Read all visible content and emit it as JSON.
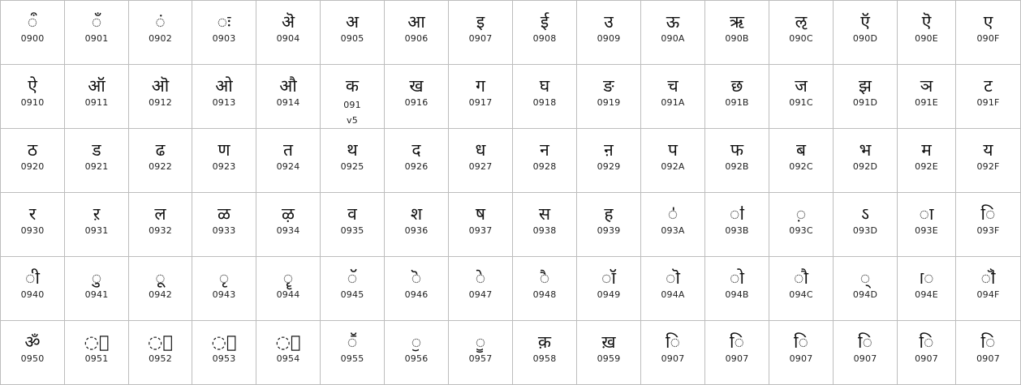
{
  "cells": [
    {
      "glyph": "◌ऀ",
      "code": "0900"
    },
    {
      "glyph": "◌ँ",
      "code": "0901"
    },
    {
      "glyph": "◌ं",
      "code": "0902"
    },
    {
      "glyph": "◌ः",
      "code": "0903"
    },
    {
      "glyph": "ऄ",
      "code": "0904"
    },
    {
      "glyph": "अ",
      "code": "0905"
    },
    {
      "glyph": "आ",
      "code": "0906"
    },
    {
      "glyph": "इ",
      "code": "0907"
    },
    {
      "glyph": "ई",
      "code": "0908"
    },
    {
      "glyph": "उ",
      "code": "0909"
    },
    {
      "glyph": "ऊ",
      "code": "090A"
    },
    {
      "glyph": "ऋ",
      "code": "090B"
    },
    {
      "glyph": "ऌ",
      "code": "090C"
    },
    {
      "glyph": "ऍ",
      "code": "090D"
    },
    {
      "glyph": "ऎ",
      "code": "090E"
    },
    {
      "glyph": "ए",
      "code": "090F"
    },
    {
      "glyph": "ऐ",
      "code": "0910"
    },
    {
      "glyph": "ऑ",
      "code": "0911"
    },
    {
      "glyph": "ऒ",
      "code": "0912"
    },
    {
      "glyph": "ओ",
      "code": "0913"
    },
    {
      "glyph": "औ",
      "code": "0914"
    },
    {
      "glyph": "क",
      "code": "091v5"
    },
    {
      "glyph": "ख",
      "code": "0916"
    },
    {
      "glyph": "ग",
      "code": "0917"
    },
    {
      "glyph": "घ",
      "code": "0918"
    },
    {
      "glyph": "ङ",
      "code": "0919"
    },
    {
      "glyph": "च",
      "code": "091A"
    },
    {
      "glyph": "छ",
      "code": "091B"
    },
    {
      "glyph": "ज",
      "code": "091C"
    },
    {
      "glyph": "झ",
      "code": "091D"
    },
    {
      "glyph": "ञ",
      "code": "091E"
    },
    {
      "glyph": "ट",
      "code": "091F"
    },
    {
      "glyph": "ठ",
      "code": "0920"
    },
    {
      "glyph": "ड",
      "code": "0921"
    },
    {
      "glyph": "ढ",
      "code": "0922"
    },
    {
      "glyph": "ण",
      "code": "0923"
    },
    {
      "glyph": "त",
      "code": "0924"
    },
    {
      "glyph": "थ",
      "code": "0925"
    },
    {
      "glyph": "द",
      "code": "0926"
    },
    {
      "glyph": "ध",
      "code": "0927"
    },
    {
      "glyph": "न",
      "code": "0928"
    },
    {
      "glyph": "ऩ",
      "code": "0929"
    },
    {
      "glyph": "प",
      "code": "092A"
    },
    {
      "glyph": "फ",
      "code": "092B"
    },
    {
      "glyph": "ब",
      "code": "092C"
    },
    {
      "glyph": "भ",
      "code": "092D"
    },
    {
      "glyph": "म",
      "code": "092E"
    },
    {
      "glyph": "य",
      "code": "092F"
    },
    {
      "glyph": "र",
      "code": "0930"
    },
    {
      "glyph": "ऱ",
      "code": "0931"
    },
    {
      "glyph": "ल",
      "code": "0932"
    },
    {
      "glyph": "ळ",
      "code": "0933"
    },
    {
      "glyph": "ऴ",
      "code": "0934"
    },
    {
      "glyph": "व",
      "code": "0935"
    },
    {
      "glyph": "श",
      "code": "0936"
    },
    {
      "glyph": "ष",
      "code": "0937"
    },
    {
      "glyph": "स",
      "code": "0938"
    },
    {
      "glyph": "ह",
      "code": "0939"
    },
    {
      "glyph": "◌ऺ",
      "code": "093A"
    },
    {
      "glyph": "◌ऻ",
      "code": "093B"
    },
    {
      "glyph": "◌़",
      "code": "093C"
    },
    {
      "glyph": "ऽ",
      "code": "093D"
    },
    {
      "glyph": "◌ा",
      "code": "093E"
    },
    {
      "glyph": "◌ि",
      "code": "093F"
    },
    {
      "glyph": "◌ी",
      "code": "0940"
    },
    {
      "glyph": "◌ु",
      "code": "0941"
    },
    {
      "glyph": "◌ू",
      "code": "0942"
    },
    {
      "glyph": "◌ृ",
      "code": "0943"
    },
    {
      "glyph": "◌ॄ",
      "code": "0944"
    },
    {
      "glyph": "◌ॅ",
      "code": "0945"
    },
    {
      "glyph": "◌ॆ",
      "code": "0946"
    },
    {
      "glyph": "◌े",
      "code": "0947"
    },
    {
      "glyph": "◌ै",
      "code": "0948"
    },
    {
      "glyph": "◌ॉ",
      "code": "0949"
    },
    {
      "glyph": "◌ॊ",
      "code": "094A"
    },
    {
      "glyph": "◌ो",
      "code": "094B"
    },
    {
      "glyph": "◌ौ",
      "code": "094C"
    },
    {
      "glyph": "◌्",
      "code": "094D"
    },
    {
      "glyph": "◌ॎ",
      "code": "094E"
    },
    {
      "glyph": "◌ॏ",
      "code": "094F"
    },
    {
      "glyph": "ॐ",
      "code": "0950"
    },
    {
      "glyph": "◌॑",
      "code": "0951"
    },
    {
      "glyph": "◌॒",
      "code": "0952"
    },
    {
      "glyph": "◌॓",
      "code": "0953"
    },
    {
      "glyph": "◌॔",
      "code": "0954"
    },
    {
      "glyph": "◌ॕ",
      "code": "0955"
    },
    {
      "glyph": "◌ॖ",
      "code": "0956"
    },
    {
      "glyph": "◌ॗ",
      "code": "0957"
    },
    {
      "glyph": "क़",
      "code": "0958"
    },
    {
      "glyph": "ख़",
      "code": "0959"
    },
    {
      "glyph": "◌ि",
      "code": "0907"
    },
    {
      "glyph": "◌ि",
      "code": "0907"
    },
    {
      "glyph": "◌ि",
      "code": "0907"
    },
    {
      "glyph": "◌ि",
      "code": "0907"
    },
    {
      "glyph": "◌ि",
      "code": "0907"
    },
    {
      "glyph": "◌ि",
      "code": "0907"
    }
  ]
}
